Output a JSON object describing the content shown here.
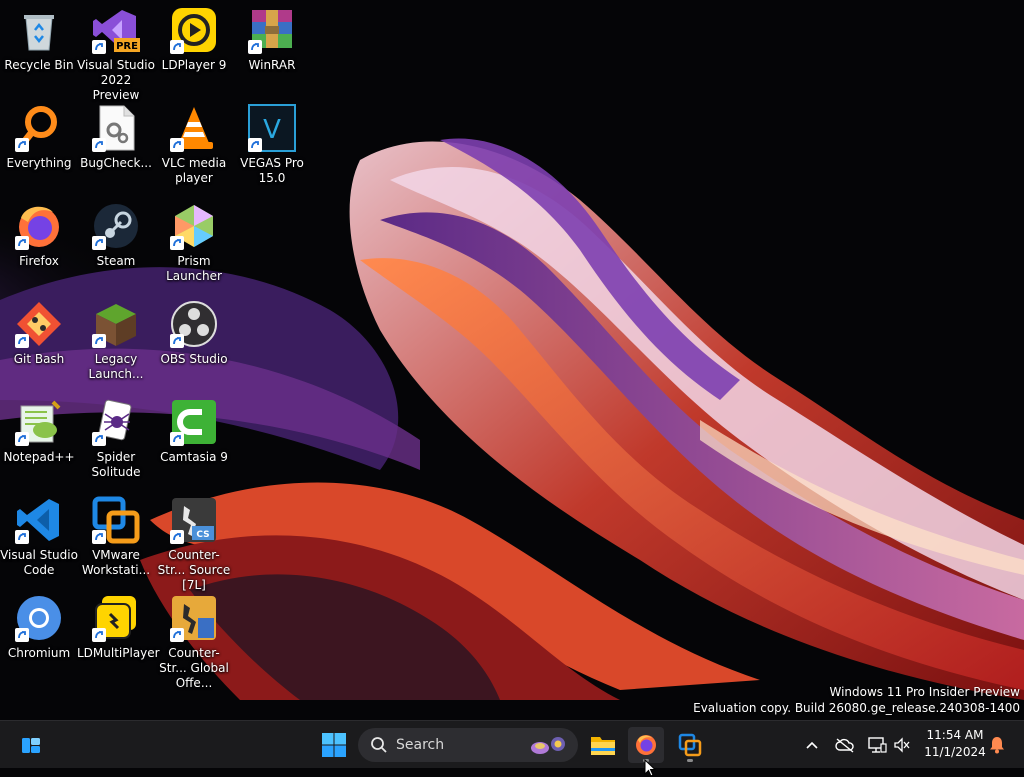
{
  "desktop": {
    "icons": [
      {
        "label": "Recycle Bin",
        "icon": "recycle-bin-icon"
      },
      {
        "label": "Visual Studio 2022 Preview",
        "icon": "visual-studio-preview-icon"
      },
      {
        "label": "LDPlayer 9",
        "icon": "ldplayer-icon"
      },
      {
        "label": "WinRAR",
        "icon": "winrar-icon"
      },
      {
        "label": "Everything",
        "icon": "everything-search-icon"
      },
      {
        "label": "BugCheck...",
        "icon": "bugcheck-file-icon"
      },
      {
        "label": "VLC media player",
        "icon": "vlc-icon"
      },
      {
        "label": "VEGAS Pro 15.0",
        "icon": "vegas-pro-icon"
      },
      {
        "label": "Firefox",
        "icon": "firefox-icon"
      },
      {
        "label": "Steam",
        "icon": "steam-icon"
      },
      {
        "label": "Prism Launcher",
        "icon": "prism-launcher-icon"
      },
      {
        "label": "Git Bash",
        "icon": "git-bash-icon"
      },
      {
        "label": "Legacy Launch...",
        "icon": "minecraft-legacy-launcher-icon"
      },
      {
        "label": "OBS Studio",
        "icon": "obs-studio-icon"
      },
      {
        "label": "Notepad++",
        "icon": "notepad-plus-plus-icon"
      },
      {
        "label": "Spider Solitude",
        "icon": "spider-solitaire-icon"
      },
      {
        "label": "Camtasia 9",
        "icon": "camtasia-icon"
      },
      {
        "label": "Visual Studio Code",
        "icon": "vscode-icon"
      },
      {
        "label": "VMware Workstati...",
        "icon": "vmware-workstation-icon"
      },
      {
        "label": "Counter-Str... Source [7L]",
        "icon": "counter-strike-source-icon"
      },
      {
        "label": "Chromium",
        "icon": "chromium-icon"
      },
      {
        "label": "LDMultiPlayer",
        "icon": "ldmultiplayer-icon"
      },
      {
        "label": "Counter-Str... Global Offe...",
        "icon": "counter-strike-go-icon"
      }
    ],
    "watermark": {
      "line1": "Windows 11 Pro Insider Preview",
      "line2": "Evaluation copy. Build 26080.ge_release.240308-1400"
    }
  },
  "taskbar": {
    "search_placeholder": "Search",
    "apps": [
      {
        "name": "File Explorer",
        "icon": "file-explorer-icon"
      },
      {
        "name": "Firefox",
        "icon": "firefox-icon",
        "running": true
      },
      {
        "name": "VMware Workstation",
        "icon": "vmware-workstation-icon",
        "running": true
      }
    ],
    "clock": {
      "time": "11:54 AM",
      "date": "11/1/2024"
    }
  },
  "colors": {
    "taskbar_bg": "#1b1b1d",
    "accent": "#0a84ff"
  }
}
